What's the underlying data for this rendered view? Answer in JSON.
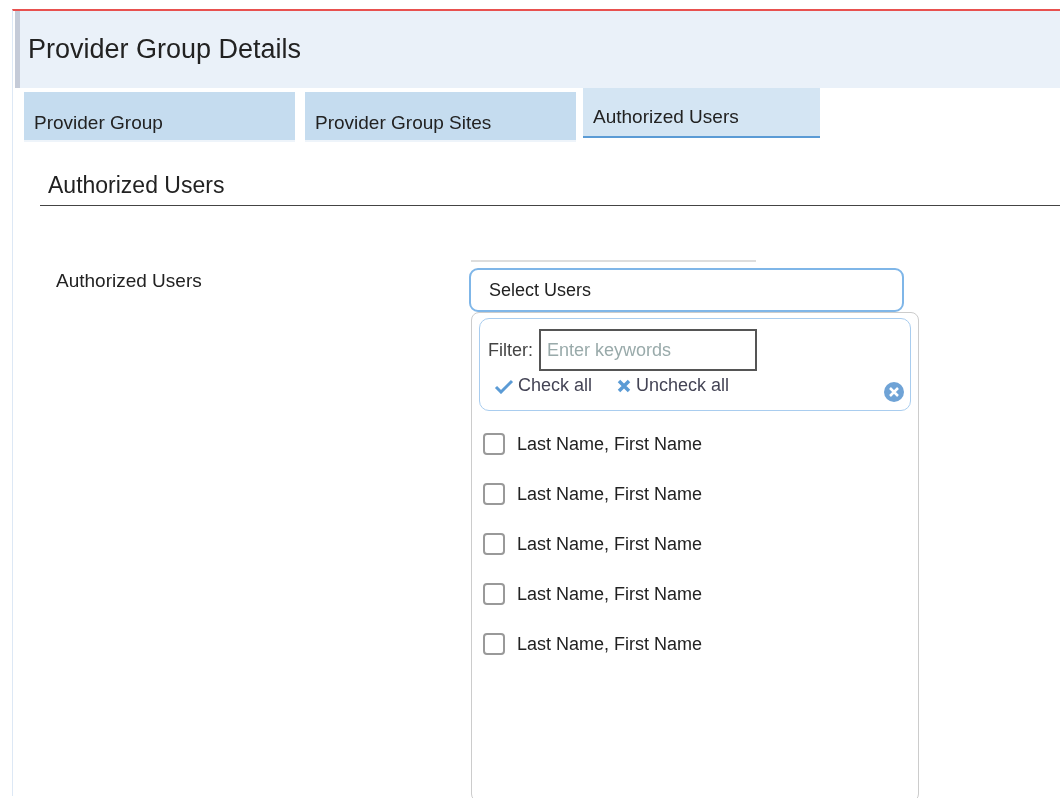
{
  "header": {
    "title": "Provider Group Details"
  },
  "tabs": [
    {
      "label": "Provider Group",
      "selected": false
    },
    {
      "label": "Provider Group Sites",
      "selected": false
    },
    {
      "label": "Authorized Users",
      "selected": true
    }
  ],
  "section": {
    "heading": "Authorized Users"
  },
  "field": {
    "label": "Authorized Users",
    "value": "Select Users"
  },
  "dropdown": {
    "filter_label": "Filter:",
    "filter_placeholder": "Enter keywords",
    "check_all": "Check all",
    "uncheck_all": "Uncheck all",
    "options": [
      {
        "label": "Last Name, First Name",
        "checked": false
      },
      {
        "label": "Last Name, First Name",
        "checked": false
      },
      {
        "label": "Last Name, First Name",
        "checked": false
      },
      {
        "label": "Last Name, First Name",
        "checked": false
      },
      {
        "label": "Last Name, First Name",
        "checked": false
      }
    ]
  }
}
